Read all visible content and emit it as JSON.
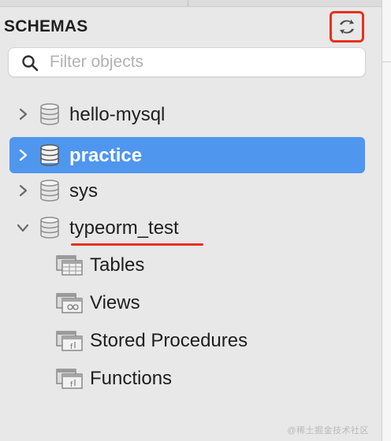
{
  "header": {
    "title": "SCHEMAS",
    "refresh_icon": "refresh-arrows-icon",
    "highlight_color": "#e8301c"
  },
  "search": {
    "placeholder": "Filter objects",
    "value": ""
  },
  "schemas": [
    {
      "name": "hello-mysql",
      "expanded": false,
      "selected": false
    },
    {
      "name": "practice",
      "expanded": false,
      "selected": true
    },
    {
      "name": "sys",
      "expanded": false,
      "selected": false
    },
    {
      "name": "typeorm_test",
      "expanded": true,
      "selected": false,
      "underlined": true
    }
  ],
  "expanded_children": [
    {
      "label": "Tables"
    },
    {
      "label": "Views"
    },
    {
      "label": "Stored Procedures"
    },
    {
      "label": "Functions"
    }
  ],
  "colors": {
    "selection": "#4f96ef",
    "annotation": "#e8301c",
    "panel_bg": "#e8e8e8"
  },
  "watermark": "@稀土掘金技术社区"
}
